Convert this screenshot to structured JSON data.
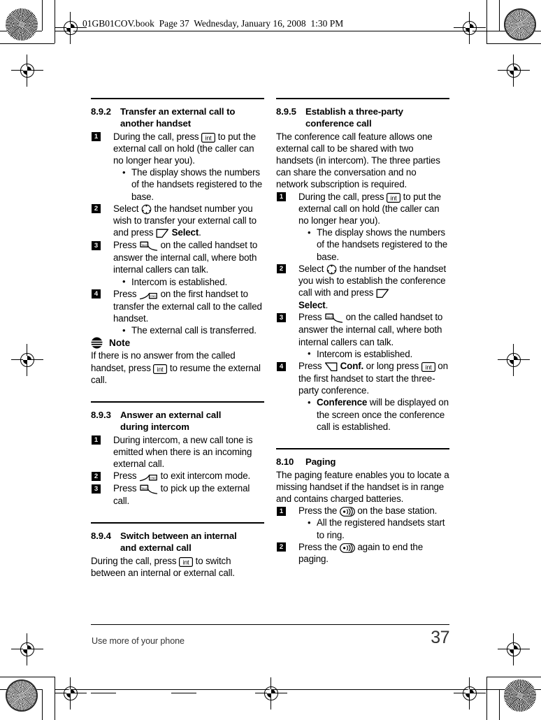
{
  "running_header": "01GB01COV.book  Page 37  Wednesday, January 16, 2008  1:30 PM",
  "footer": {
    "chapter_label": "Use more of your phone",
    "page_number": "37"
  },
  "icons": {
    "int": "int-key-icon",
    "nav": "navigation-key-icon",
    "softkey_left": "left-soft-key-icon",
    "softkey_right": "right-soft-key-icon",
    "talk": "talk-key-icon",
    "end": "end-key-icon",
    "paging": "paging-key-icon",
    "note": "note-icon",
    "talk_label": "TALK",
    "end_label": "END",
    "int_label": "int"
  },
  "colors": {
    "text": "#000000",
    "step_badge_bg": "#000000",
    "step_badge_fg": "#ffffff",
    "footer_text": "#333333"
  },
  "left_column": {
    "sections": [
      {
        "number": "8.9.2",
        "title_line1": "Transfer an external call to",
        "title_line2": "another handset",
        "steps": [
          {
            "num": "1",
            "text_before": "During the call, press ",
            "icon": "int",
            "text_after": " to put the external call on hold (the caller can no longer hear you).",
            "bullets": [
              "The display shows the numbers of the handsets registered to the base."
            ]
          },
          {
            "num": "2",
            "text_before": "Select ",
            "icon": "nav",
            "text_after": " the handset number you wish to transfer your external call to and press ",
            "icon2": "softkey_left",
            "bold_after": "Select",
            "text_end": ".",
            "bullets": []
          },
          {
            "num": "3",
            "text_before": "Press ",
            "icon": "talk",
            "text_after": " on the called handset to answer the internal call, where both internal callers can talk.",
            "bullets": [
              "Intercom is established."
            ]
          },
          {
            "num": "4",
            "text_before": "Press ",
            "icon": "end",
            "text_after": " on the first handset to transfer the external call to the called handset.",
            "bullets": [
              "The external call is transferred."
            ]
          }
        ],
        "note": {
          "title": "Note",
          "text_before": "If there is no answer from the called handset, press ",
          "icon": "int",
          "text_after": " to resume the external call."
        }
      },
      {
        "number": "8.9.3",
        "title_line1": "Answer an external call",
        "title_line2": "during intercom",
        "steps": [
          {
            "num": "1",
            "text_before": "During intercom, a new call tone is emitted when there is an incoming external call.",
            "bullets": []
          },
          {
            "num": "2",
            "text_before": "Press ",
            "icon": "end",
            "text_after": " to exit intercom mode.",
            "bullets": []
          },
          {
            "num": "3",
            "text_before": "Press ",
            "icon": "talk",
            "text_after": " to pick up the external call.",
            "bullets": []
          }
        ]
      },
      {
        "number": "8.9.4",
        "title_line1": "Switch between an internal",
        "title_line2": "and external call",
        "paragraph_before": "During the call, press ",
        "paragraph_icon": "int",
        "paragraph_after": " to switch between an internal or external call."
      }
    ]
  },
  "right_column": {
    "sections": [
      {
        "number": "8.9.5",
        "title_line1": "Establish a three-party",
        "title_line2": "conference call",
        "intro": "The conference call feature allows one external call to be shared with two handsets (in intercom). The three parties can share the conversation and no network subscription is required.",
        "steps": [
          {
            "num": "1",
            "text_before": "During the call, press ",
            "icon": "int",
            "text_after": " to put the external call on hold (the caller can no longer hear you).",
            "bullets": [
              "The display shows the numbers of the handsets registered to the base."
            ]
          },
          {
            "num": "2",
            "text_before": "Select ",
            "icon": "nav",
            "text_after": " the number of the handset you wish to establish the conference call with and press ",
            "icon2": "softkey_left",
            "bold_after": "Select",
            "text_end": ".",
            "bullets": []
          },
          {
            "num": "3",
            "text_before": "Press ",
            "icon": "talk",
            "text_after": " on the called handset to answer the internal call, where both internal callers can talk.",
            "bullets": [
              "Intercom is established."
            ]
          },
          {
            "num": "4",
            "text_before": "Press ",
            "icon": "softkey_right",
            "bold_mid": "Conf.",
            "text_mid": " or long press ",
            "icon2": "int",
            "text_after": " on the first handset to start the three-party conference.",
            "bullet_bold": "Conference",
            "bullet_rest": " will be displayed on the screen once the conference call is established."
          }
        ]
      },
      {
        "number": "8.10",
        "title_line1": "Paging",
        "intro": "The paging feature enables you to locate a missing handset if the handset is in range and contains charged batteries.",
        "steps": [
          {
            "num": "1",
            "text_before": "Press the ",
            "icon": "paging",
            "text_after": " on the base station.",
            "bullets": [
              "All the registered handsets start to ring."
            ]
          },
          {
            "num": "2",
            "text_before": "Press the ",
            "icon": "paging",
            "text_after": " again to end the paging.",
            "bullets": []
          }
        ]
      }
    ]
  }
}
